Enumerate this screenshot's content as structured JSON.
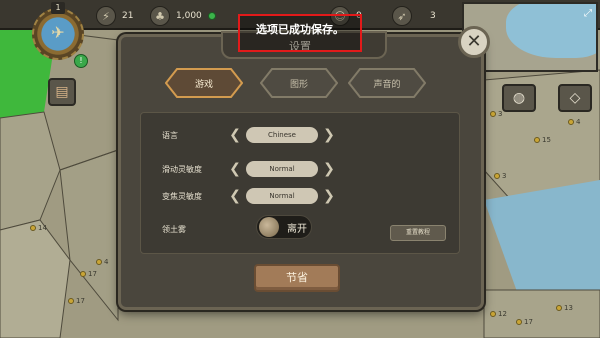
{
  "hud": {
    "level": "1",
    "resources": [
      {
        "icon": "lightning-icon",
        "glyph": "⚡",
        "value": "21"
      },
      {
        "icon": "coins-icon",
        "glyph": "♣",
        "value": "1,000"
      },
      {
        "icon": "people-icon",
        "glyph": "☺",
        "value": "0"
      },
      {
        "icon": "rocket-icon",
        "glyph": "➶",
        "value": "3"
      }
    ]
  },
  "map": {
    "cities": [
      "14",
      "4",
      "17",
      "17",
      "3",
      "3",
      "15",
      "4",
      "12",
      "17",
      "13"
    ]
  },
  "toast": {
    "text": "选项已成功保存。"
  },
  "settings": {
    "title": "设置",
    "tabs": [
      {
        "label": "游戏",
        "active": true
      },
      {
        "label": "图形",
        "active": false
      },
      {
        "label": "声音的",
        "active": false
      }
    ],
    "rows": [
      {
        "label": "语言",
        "value": "Chinese"
      },
      {
        "label": "滑动灵敏度",
        "value": "Normal"
      },
      {
        "label": "变焦灵敏度",
        "value": "Normal"
      }
    ],
    "fog": {
      "label": "领土雾",
      "state": "离开"
    },
    "tutorial_button": "重置教程",
    "save_button": "节省"
  }
}
